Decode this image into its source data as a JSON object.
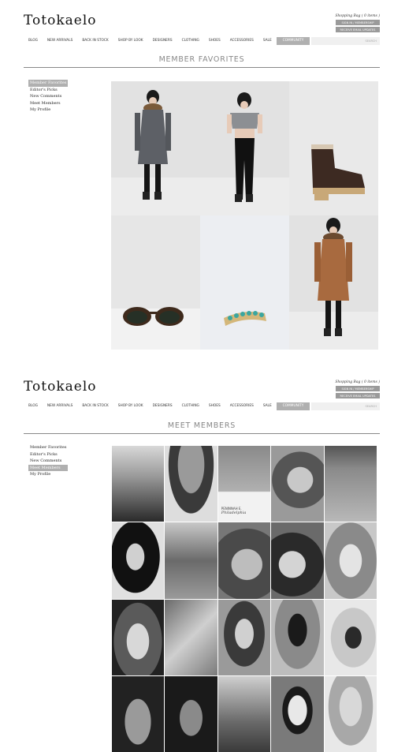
{
  "brand": {
    "logo": "Totokaelo"
  },
  "utility": {
    "bag": "Shopping Bag ( 0 items )",
    "sign_in": "SIGN IN / MEMBERSHIP",
    "email": "RECEIVE EMAIL UPDATES"
  },
  "nav": {
    "items": [
      "BLOG",
      "NEW ARRIVALS",
      "BACK IN STOCK",
      "SHOP BY LOOK",
      "DESIGNERS",
      "CLOTHING",
      "SHOES",
      "ACCESSORIES",
      "SALE",
      "COMMUNITY"
    ],
    "active": "COMMUNITY",
    "search_label": "SEARCH"
  },
  "sidebar": {
    "items": [
      "Member Favorites",
      "Editor's Picks",
      "New Comments",
      "Meet Members",
      "My Profile"
    ]
  },
  "favorites": {
    "title": "MEMBER FAVORITES",
    "active_item": "Member Favorites",
    "products": [
      {
        "name": "Hooded parka with fur trim",
        "icon": "model-gray-parka"
      },
      {
        "name": "Cropped gray top with black leggings",
        "icon": "model-gray-top"
      },
      {
        "name": "Shearling clog boot",
        "icon": "brown-boot"
      },
      {
        "name": "Tortoise sunglasses",
        "icon": "sunglasses"
      },
      {
        "name": "Turquoise stone ring",
        "icon": "ring"
      },
      {
        "name": "Rust parka with fur trim",
        "icon": "model-rust-parka"
      }
    ]
  },
  "members": {
    "title": "MEET MEMBERS",
    "active_item": "Meet Members",
    "caption_name": "PENINNAH E.",
    "caption_city": "Philadelphia",
    "photos": 20
  },
  "colors": {
    "accent_gray": "#b0b0b0",
    "button_gray": "#9a9a9a",
    "title_gray": "#888888"
  }
}
